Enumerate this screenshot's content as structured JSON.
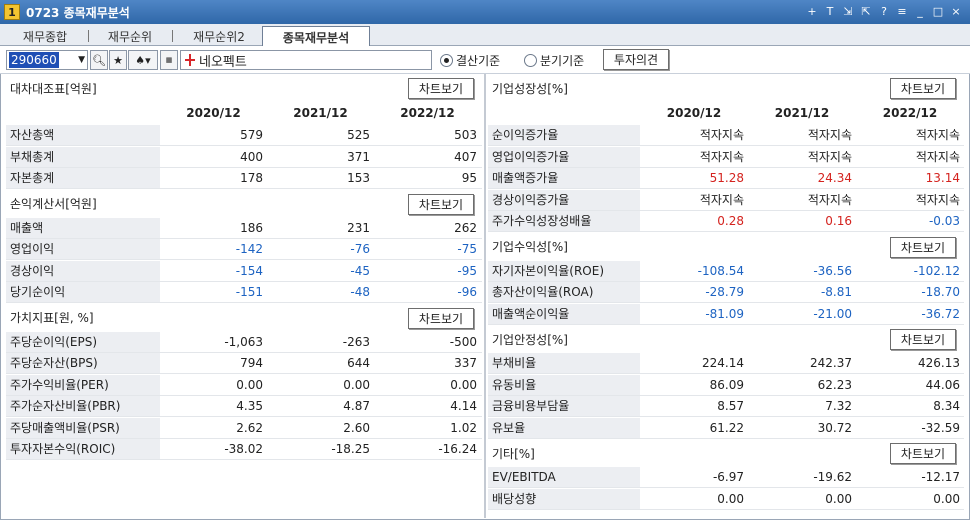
{
  "window": {
    "number": "1",
    "title": "0723 종목재무분석",
    "controls": [
      "+",
      "T",
      "⇲",
      "⇱",
      "?",
      "≡",
      "_",
      "□",
      "×"
    ]
  },
  "tabs": [
    "재무종합",
    "재무순위",
    "재무순위2",
    "종목재무분석"
  ],
  "active_tab": "종목재무분석",
  "toolbar": {
    "code": "290660",
    "stock_name": "네오펙트",
    "radio_settle": "결산기준",
    "radio_quarter": "분기기준",
    "opinion_btn": "투자의견"
  },
  "chart_btn_label": "차트보기",
  "years": [
    "2020/12",
    "2021/12",
    "2022/12"
  ],
  "left": {
    "balance": {
      "title": "대차대조표[억원]",
      "rows": [
        {
          "label": "자산총액",
          "v": [
            "579",
            "525",
            "503"
          ]
        },
        {
          "label": "부채총계",
          "v": [
            "400",
            "371",
            "407"
          ]
        },
        {
          "label": "자본총계",
          "v": [
            "178",
            "153",
            "95"
          ]
        }
      ]
    },
    "income": {
      "title": "손익계산서[억원]",
      "rows": [
        {
          "label": "매출액",
          "v": [
            "186",
            "231",
            "262"
          ]
        },
        {
          "label": "영업이익",
          "v": [
            "-142",
            "-76",
            "-75"
          ]
        },
        {
          "label": "경상이익",
          "v": [
            "-154",
            "-45",
            "-95"
          ]
        },
        {
          "label": "당기순이익",
          "v": [
            "-151",
            "-48",
            "-96"
          ]
        }
      ]
    },
    "value": {
      "title": "가치지표[원, %]",
      "rows": [
        {
          "label": "주당순이익(EPS)",
          "v": [
            "-1,063",
            "-263",
            "-500"
          ]
        },
        {
          "label": "주당순자산(BPS)",
          "v": [
            "794",
            "644",
            "337"
          ]
        },
        {
          "label": "주가수익비율(PER)",
          "v": [
            "0.00",
            "0.00",
            "0.00"
          ]
        },
        {
          "label": "주가순자산비율(PBR)",
          "v": [
            "4.35",
            "4.87",
            "4.14"
          ]
        },
        {
          "label": "주당매출액비율(PSR)",
          "v": [
            "2.62",
            "2.60",
            "1.02"
          ]
        },
        {
          "label": "투자자본수익(ROIC)",
          "v": [
            "-38.02",
            "-18.25",
            "-16.24"
          ]
        }
      ]
    }
  },
  "right": {
    "growth": {
      "title": "기업성장성[%]",
      "rows": [
        {
          "label": "순이익증가율",
          "v": [
            "적자지속",
            "적자지속",
            "적자지속"
          ],
          "c": [
            "",
            "",
            ""
          ]
        },
        {
          "label": "영업이익증가율",
          "v": [
            "적자지속",
            "적자지속",
            "적자지속"
          ],
          "c": [
            "",
            "",
            ""
          ]
        },
        {
          "label": "매출액증가율",
          "v": [
            "51.28",
            "24.34",
            "13.14"
          ],
          "c": [
            "pos",
            "pos",
            "pos"
          ]
        },
        {
          "label": "경상이익증가율",
          "v": [
            "적자지속",
            "적자지속",
            "적자지속"
          ],
          "c": [
            "",
            "",
            ""
          ]
        },
        {
          "label": "주가수익성장성배율",
          "v": [
            "0.28",
            "0.16",
            "-0.03"
          ],
          "c": [
            "pos",
            "pos",
            "neg"
          ]
        }
      ]
    },
    "profit": {
      "title": "기업수익성[%]",
      "rows": [
        {
          "label": "자기자본이익율(ROE)",
          "v": [
            "-108.54",
            "-36.56",
            "-102.12"
          ],
          "c": [
            "neg",
            "neg",
            "neg"
          ]
        },
        {
          "label": "총자산이익율(ROA)",
          "v": [
            "-28.79",
            "-8.81",
            "-18.70"
          ],
          "c": [
            "neg",
            "neg",
            "neg"
          ]
        },
        {
          "label": "매출액순이익율",
          "v": [
            "-81.09",
            "-21.00",
            "-36.72"
          ],
          "c": [
            "neg",
            "neg",
            "neg"
          ]
        }
      ]
    },
    "stability": {
      "title": "기업안정성[%]",
      "rows": [
        {
          "label": "부채비율",
          "v": [
            "224.14",
            "242.37",
            "426.13"
          ],
          "c": [
            "",
            "",
            ""
          ]
        },
        {
          "label": "유동비율",
          "v": [
            "86.09",
            "62.23",
            "44.06"
          ],
          "c": [
            "",
            "",
            ""
          ]
        },
        {
          "label": "금융비용부담율",
          "v": [
            "8.57",
            "7.32",
            "8.34"
          ],
          "c": [
            "",
            "",
            ""
          ]
        },
        {
          "label": "유보율",
          "v": [
            "61.22",
            "30.72",
            "-32.59"
          ],
          "c": [
            "",
            "",
            ""
          ]
        }
      ]
    },
    "etc": {
      "title": "기타[%]",
      "rows": [
        {
          "label": "EV/EBITDA",
          "v": [
            "-6.97",
            "-19.62",
            "-12.17"
          ],
          "c": [
            "",
            "",
            ""
          ]
        },
        {
          "label": "배당성향",
          "v": [
            "0.00",
            "0.00",
            "0.00"
          ],
          "c": [
            "",
            "",
            ""
          ]
        }
      ]
    }
  },
  "colors": {
    "negative": "#1d63c2",
    "positive": "#d4231f",
    "title_bar": "#2f67a8"
  }
}
